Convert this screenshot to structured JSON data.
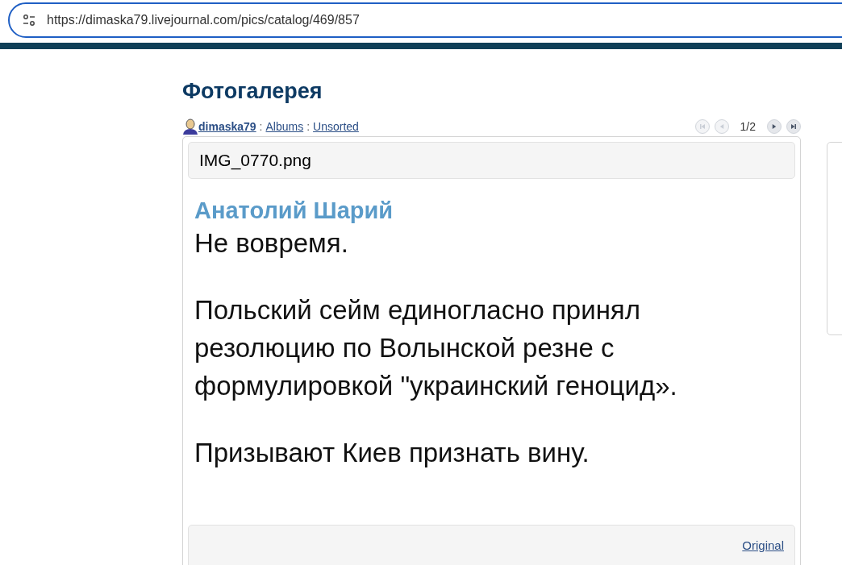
{
  "address_bar": {
    "url": "https://dimaska79.livejournal.com/pics/catalog/469/857"
  },
  "page_title": "Фотогалерея",
  "breadcrumb": {
    "user": "dimaska79",
    "separator_1": ":",
    "albums": "Albums",
    "separator_2": ":",
    "album": "Unsorted"
  },
  "pager": {
    "counter": "1/2",
    "buttons": [
      {
        "kind": "first",
        "disabled": true
      },
      {
        "kind": "prev",
        "disabled": true
      },
      {
        "kind": "next",
        "disabled": false
      },
      {
        "kind": "last",
        "disabled": false
      }
    ]
  },
  "photo": {
    "filename": "IMG_0770.png",
    "post": {
      "author": "Анатолий Шарий",
      "paragraphs": [
        "Не вовремя.",
        "Польский сейм единогласно принял резолюцию по Волынской резне с формулировкой \"украинский геноцид».",
        "Призывают Киев признать вину."
      ]
    }
  },
  "footer": {
    "link": "Original"
  }
}
